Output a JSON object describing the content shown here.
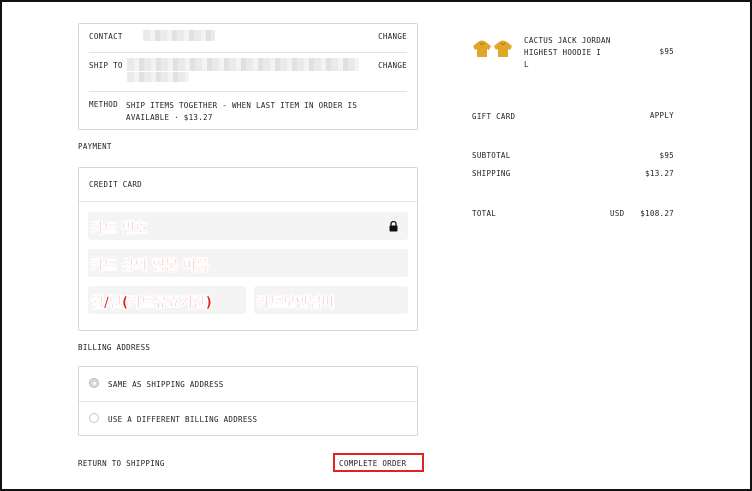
{
  "summary": {
    "contact_label": "CONTACT",
    "ship_to_label": "SHIP TO",
    "method_label": "METHOD",
    "method_value": "SHIP ITEMS TOGETHER - WHEN LAST ITEM IN ORDER IS AVAILABLE · $13.27",
    "change_label": "CHANGE"
  },
  "payment": {
    "title": "PAYMENT",
    "method_label": "CREDIT CARD",
    "card_number_note": "카드 번호",
    "card_name_note": "카드 상의 영문 이름",
    "expiry_note": "월/년(카드유효기간)",
    "cvv_note": "카드보안넘버"
  },
  "billing": {
    "title": "BILLING ADDRESS",
    "options": [
      {
        "label": "SAME AS SHIPPING ADDRESS",
        "selected": true
      },
      {
        "label": "USE A DIFFERENT BILLING ADDRESS",
        "selected": false
      }
    ]
  },
  "footer": {
    "return_label": "RETURN TO SHIPPING",
    "complete_label": "COMPLETE ORDER",
    "highlight_color": "#e0231f"
  },
  "cart": {
    "item": {
      "name": "CACTUS JACK JORDAN HIGHEST HOODIE I L",
      "name_lines": [
        "CACTUS JACK JORDAN",
        "HIGHEST HOODIE I",
        "L"
      ],
      "price": "$95",
      "color": "#e0a62a"
    },
    "gift_card_label": "GIFT CARD",
    "apply_label": "APPLY",
    "subtotal_label": "SUBTOTAL",
    "subtotal_value": "$95",
    "shipping_label": "SHIPPING",
    "shipping_value": "$13.27",
    "total_label": "TOTAL",
    "currency": "USD",
    "total_value": "$108.27"
  }
}
